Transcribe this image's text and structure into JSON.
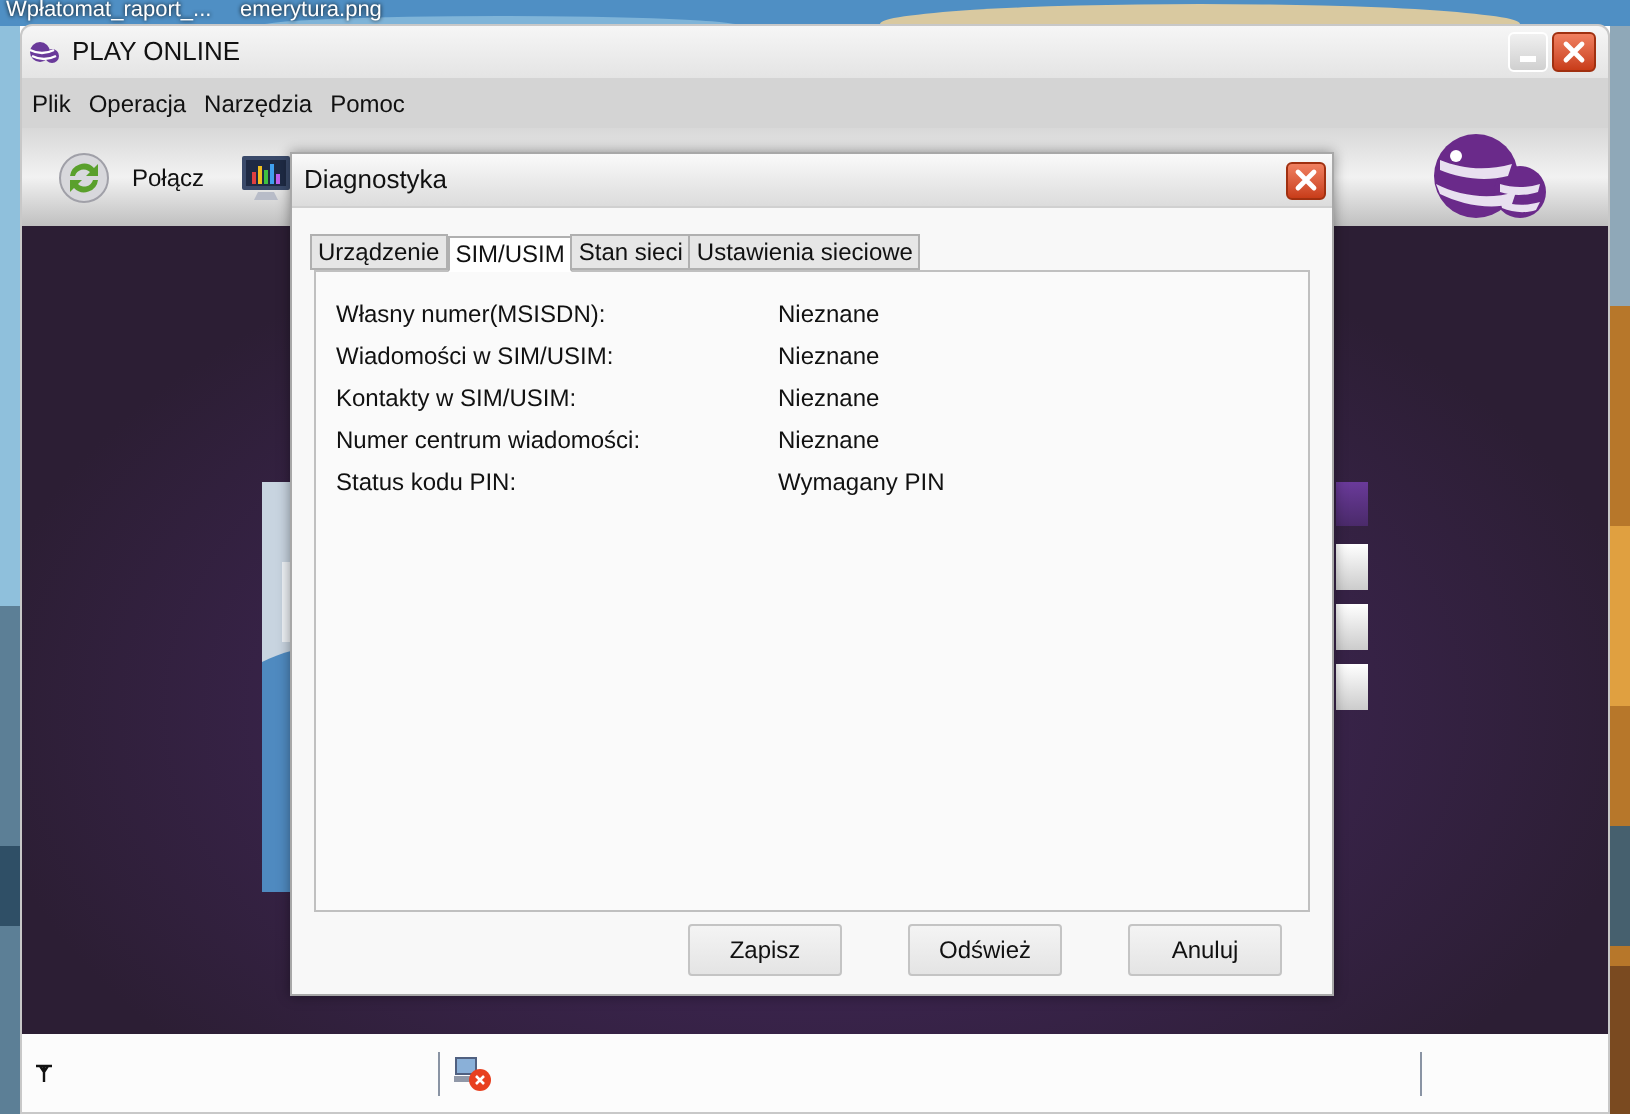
{
  "desktop_icons": [
    {
      "label": "Wpłatomat_raport_..."
    },
    {
      "label": "emerytura.png"
    }
  ],
  "window": {
    "title": "PLAY ONLINE"
  },
  "menu": [
    "Plik",
    "Operacja",
    "Narzędzia",
    "Pomoc"
  ],
  "toolbar": {
    "connect_label": "Połącz"
  },
  "dialog": {
    "title": "Diagnostyka",
    "tabs": [
      {
        "label": "Urządzenie",
        "selected": false
      },
      {
        "label": "SIM/USIM",
        "selected": true
      },
      {
        "label": "Stan sieci",
        "selected": false
      },
      {
        "label": "Ustawienia sieciowe",
        "selected": false
      }
    ],
    "fields": [
      {
        "label": "Własny numer(MSISDN):",
        "value": "Nieznane"
      },
      {
        "label": "Wiadomości w SIM/USIM:",
        "value": "Nieznane"
      },
      {
        "label": "Kontakty w SIM/USIM:",
        "value": "Nieznane"
      },
      {
        "label": "Numer centrum wiadomości:",
        "value": "Nieznane"
      },
      {
        "label": "Status kodu PIN:",
        "value": "Wymagany PIN"
      }
    ],
    "buttons": [
      "Zapisz",
      "Odśwież",
      "Anuluj"
    ]
  }
}
